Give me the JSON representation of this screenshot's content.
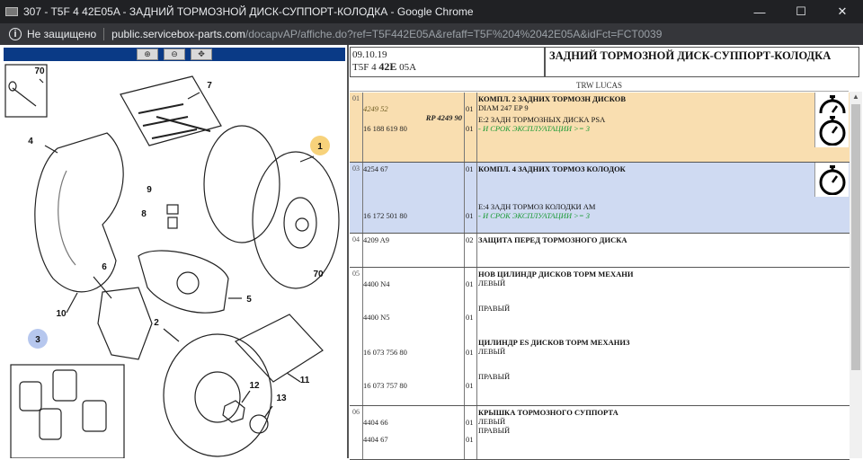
{
  "window": {
    "title": "307 - T5F 4 42E05A - ЗАДНИЙ ТОРМОЗНОЙ ДИСК-СУППОРТ-КОЛОДКА - Google Chrome",
    "minimize": "—",
    "maximize": "☐",
    "close": "✕"
  },
  "address": {
    "security": "Не защищено",
    "separator": "|",
    "host": "public.servicebox-parts.com",
    "path": "/docapvAP/affiche.do?ref=T5F442E05A&refaff=T5F%204%2042E05A&idFct=FCT0039"
  },
  "header": {
    "date": "09.10.19",
    "code_prefix": "T5F 4 ",
    "code_bold": "42E",
    "code_suffix": " 05A",
    "title": "ЗАДНИЙ ТОРМОЗНОЙ ДИСК-СУППОРТ-КОЛОДКА",
    "brand": "TRW LUCAS"
  },
  "diagram": {
    "labels": [
      "70",
      "7",
      "4",
      "1",
      "9",
      "8",
      "6",
      "10",
      "70",
      "5",
      "2",
      "3",
      "11",
      "12",
      "13"
    ]
  },
  "groups": [
    {
      "num": "01",
      "bg": "#f9deb0",
      "rows": [
        {
          "ref": "4249 52",
          "ref_italic": true,
          "rp": "RP 4249 90",
          "qty": "01",
          "title": "КОМПЛ. 2 ЗАДНИХ ТОРМОЗН ДИСКОВ",
          "line": "DIAM 247 EP 9",
          "note": ""
        },
        {
          "ref": "16 188 619 80",
          "ref_italic": false,
          "rp": "",
          "qty": "01",
          "title": "",
          "line": "E:2 ЗАДН ТОРМОЗНЫХ ДИСКА PSA",
          "note": "- И СРОК ЭКСПЛУАТАЦИИ >= 3"
        }
      ]
    },
    {
      "num": "03",
      "bg": "#cfdaf2",
      "rows": [
        {
          "ref": "4254 67",
          "ref_italic": false,
          "rp": "",
          "qty": "01",
          "title": "КОМПЛ. 4 ЗАДНИХ ТОРМОЗ КОЛОДОК",
          "line": "",
          "note": ""
        },
        {
          "ref": "16 172 501 80",
          "ref_italic": false,
          "rp": "",
          "qty": "01",
          "title": "",
          "line": "E:4 ЗАДН ТОРМОЗ КОЛОДКИ AM",
          "note": "- И СРОК ЭКСПЛУАТАЦИИ >= 3"
        }
      ]
    },
    {
      "num": "04",
      "bg": "#ffffff",
      "rows": [
        {
          "ref": "4209 A9",
          "ref_italic": false,
          "rp": "",
          "qty": "02",
          "title": "ЗАЩИТА ПЕРЕД ТОРМОЗНОГО ДИСКА",
          "line": "",
          "note": ""
        }
      ]
    },
    {
      "num": "05",
      "bg": "#ffffff",
      "rows": [
        {
          "ref": "4400 N4",
          "ref_italic": false,
          "rp": "",
          "qty": "01",
          "title": "НОВ ЦИЛИНДР ДИСКОВ ТОРМ МЕХАНИ",
          "line": "ЛЕВЫЙ",
          "note": ""
        },
        {
          "ref": "4400 N5",
          "ref_italic": false,
          "rp": "",
          "qty": "01",
          "title": "",
          "line": "ПРАВЫЙ",
          "note": ""
        },
        {
          "ref": "16 073 756 80",
          "ref_italic": false,
          "rp": "",
          "qty": "01",
          "title": "ЦИЛИНДР ES ДИСКОВ ТОРМ МЕХАНИЗ",
          "line": "ЛЕВЫЙ",
          "note": ""
        },
        {
          "ref": "16 073 757 80",
          "ref_italic": false,
          "rp": "",
          "qty": "01",
          "title": "",
          "line": "ПРАВЫЙ",
          "note": ""
        }
      ]
    },
    {
      "num": "06",
      "bg": "#ffffff",
      "rows": [
        {
          "ref": "4404 66",
          "ref_italic": false,
          "rp": "",
          "qty": "01",
          "title": "КРЫШКА ТОРМОЗНОГО СУППОРТА",
          "line": "ЛЕВЫЙ",
          "note": ""
        },
        {
          "ref": "4404 67",
          "ref_italic": false,
          "rp": "",
          "qty": "01",
          "title": "",
          "line": "ПРАВЫЙ",
          "note": ""
        }
      ]
    }
  ]
}
